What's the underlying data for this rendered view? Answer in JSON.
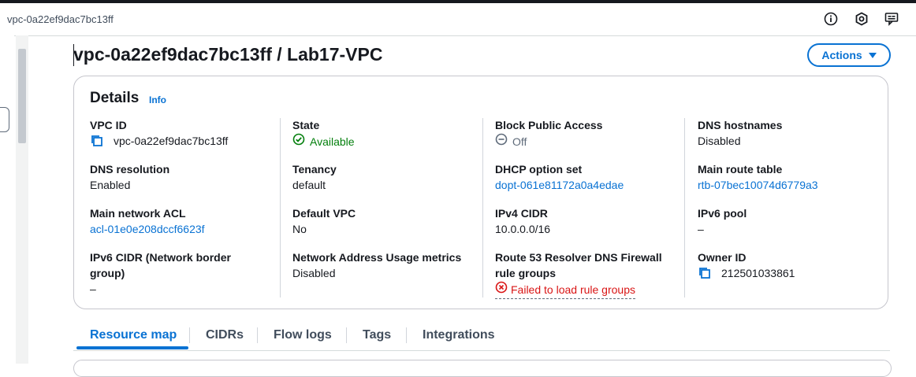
{
  "browser": {
    "tab_title": "vpc-0a22ef9dac7bc13ff"
  },
  "header": {
    "icons": [
      "info-circle-icon",
      "settings-hex-icon",
      "feedback-icon"
    ]
  },
  "page": {
    "title": "vpc-0a22ef9dac7bc13ff / Lab17-VPC",
    "actions_label": "Actions"
  },
  "details": {
    "heading": "Details",
    "info": "Info",
    "vpc_id_label": "VPC ID",
    "vpc_id_value": "vpc-0a22ef9dac7bc13ff",
    "state_label": "State",
    "state_value": "Available",
    "block_public_access_label": "Block Public Access",
    "block_public_access_value": "Off",
    "dns_hostnames_label": "DNS hostnames",
    "dns_hostnames_value": "Disabled",
    "dns_resolution_label": "DNS resolution",
    "dns_resolution_value": "Enabled",
    "tenancy_label": "Tenancy",
    "tenancy_value": "default",
    "dhcp_label": "DHCP option set",
    "dhcp_value": "dopt-061e81172a0a4edae",
    "main_route_table_label": "Main route table",
    "main_route_table_value": "rtb-07bec10074d6779a3",
    "main_acl_label": "Main network ACL",
    "main_acl_value": "acl-01e0e208dccf6623f",
    "default_vpc_label": "Default VPC",
    "default_vpc_value": "No",
    "ipv4_cidr_label": "IPv4 CIDR",
    "ipv4_cidr_value": "10.0.0.0/16",
    "ipv6_pool_label": "IPv6 pool",
    "ipv6_pool_value": "–",
    "ipv6_cidr_label_1": "IPv6 CIDR (Network border",
    "ipv6_cidr_label_2": "group)",
    "ipv6_cidr_value": "–",
    "nau_label": "Network Address Usage metrics",
    "nau_value": "Disabled",
    "r53_label_1": "Route 53 Resolver DNS Firewall",
    "r53_label_2": "rule groups",
    "r53_value": "Failed to load rule groups",
    "owner_label": "Owner ID",
    "owner_value": "212501033861"
  },
  "tabs": [
    "Resource map",
    "CIDRs",
    "Flow logs",
    "Tags",
    "Integrations"
  ],
  "colors": {
    "link": "#0972d3",
    "success": "#037f0c",
    "error": "#d91515"
  }
}
